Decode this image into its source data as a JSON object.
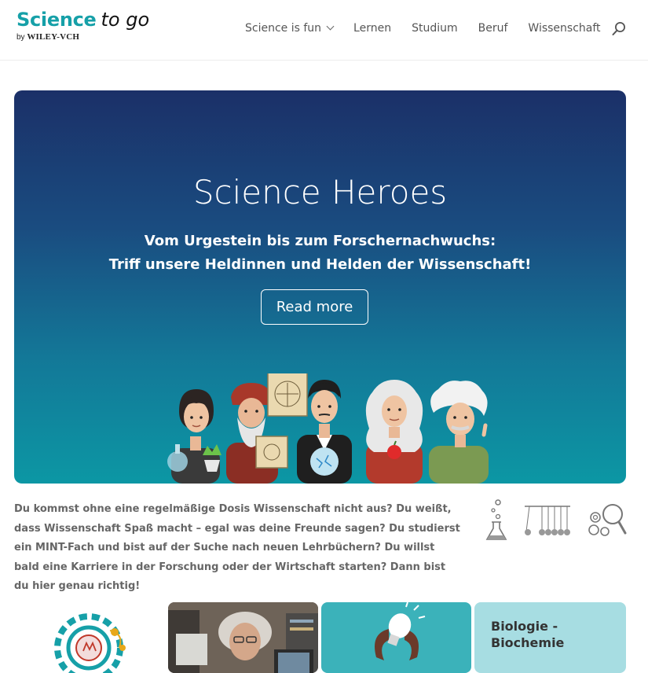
{
  "brand": {
    "name_primary": "Science",
    "name_secondary": "to go",
    "by_label": "by",
    "publisher": "WILEY-VCH"
  },
  "nav": {
    "items": [
      {
        "label": "Science is fun",
        "has_dropdown": true
      },
      {
        "label": "Lernen"
      },
      {
        "label": "Studium"
      },
      {
        "label": "Beruf"
      },
      {
        "label": "Wissenschaft"
      }
    ],
    "search_icon": "search-icon"
  },
  "hero": {
    "title": "Science Heroes",
    "subtitle_line1": "Vom Urgestein bis zum Forschernachwuchs:",
    "subtitle_line2": "Triff unsere Heldinnen und Helden der Wissenschaft!",
    "button_label": "Read more",
    "gradient_top": "#1b3068",
    "gradient_bottom": "#0c97a4"
  },
  "intro": {
    "text": "Du kommst ohne eine regelmäßige Dosis Wissenschaft nicht aus? Du weißt, dass Wissenschaft Spaß macht – egal was deine Freunde sagen? Du studierst ein MINT-Fach und bist auf der Suche nach neuen Lehrbüchern? Du willst bald eine Karriere in der Forschung oder der Wirtschaft starten? Dann bist du hier genau richtig!",
    "icons": [
      "flask-icon",
      "newtons-cradle-icon",
      "gears-magnifier-icon"
    ]
  },
  "tiles": [
    {
      "icon": "gear-molecule-icon"
    },
    {
      "image": "scientist-photo"
    },
    {
      "icon": "lightbulb-icon"
    },
    {
      "title_line1": "Biologie -",
      "title_line2": "Biochemie"
    }
  ],
  "colors": {
    "accent": "#16a0a8",
    "nav_text": "#555555",
    "body_text": "#666666"
  }
}
